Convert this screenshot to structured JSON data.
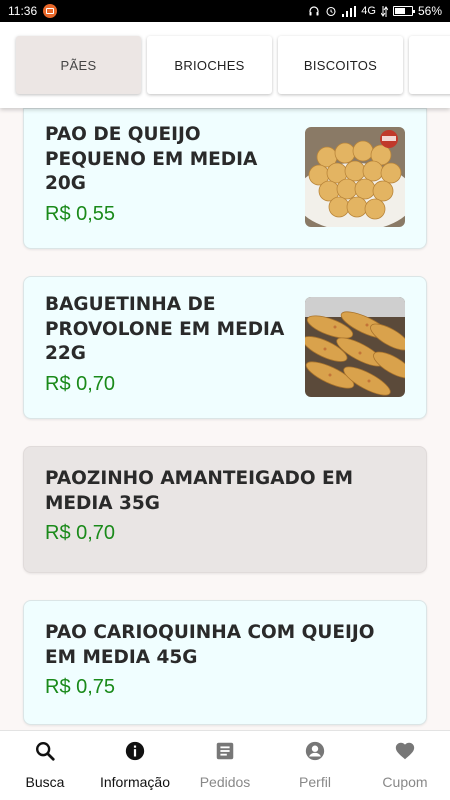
{
  "status_bar": {
    "time": "11:36",
    "network": "4G",
    "battery": "56%"
  },
  "categories": [
    {
      "label": "PÃES",
      "active": true
    },
    {
      "label": "BRIOCHES",
      "active": false
    },
    {
      "label": "BISCOITOS",
      "active": false
    },
    {
      "label": "",
      "active": false
    }
  ],
  "products": [
    {
      "name": "PAO DE QUEIJO PEQUENO EM MEDIA 20G",
      "price": "R$ 0,55",
      "image": "pao-de-queijo"
    },
    {
      "name": "BAGUETINHA DE PROVOLONE EM MEDIA 22G",
      "price": "R$ 0,70",
      "image": "baguetinha"
    },
    {
      "name": "PAOZINHO AMANTEIGADO EM MEDIA 35G",
      "price": "R$ 0,70",
      "image": ""
    },
    {
      "name": "PAO CARIOQUINHA COM QUEIJO EM MEDIA 45G",
      "price": "R$ 0,75",
      "image": ""
    }
  ],
  "bottom_nav": [
    {
      "label": "Busca",
      "icon": "search-icon"
    },
    {
      "label": "Informação",
      "icon": "info-icon"
    },
    {
      "label": "Pedidos",
      "icon": "receipt-icon"
    },
    {
      "label": "Perfil",
      "icon": "account-icon"
    },
    {
      "label": "Cupom",
      "icon": "heart-icon"
    }
  ],
  "colors": {
    "price": "#1a8a1a",
    "card_bg": "#f0feff",
    "card_bg_no_image": "#e9e5e4",
    "active_tab": "#ece6e4"
  }
}
